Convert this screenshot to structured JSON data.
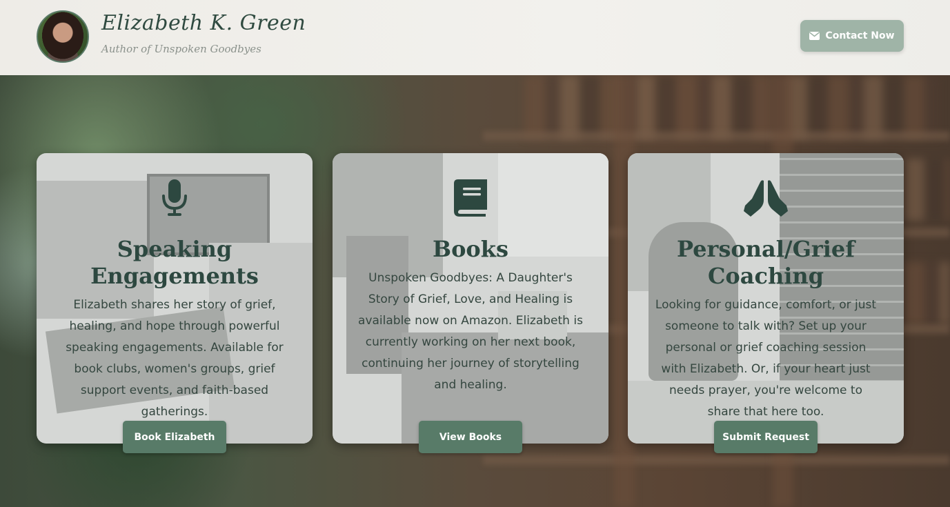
{
  "header": {
    "name": "Elizabeth K. Green",
    "tagline": "Author of Unspoken Goodbyes",
    "contact_label": "Contact Now",
    "contact_icon": "envelope-icon"
  },
  "colors": {
    "accent": "#587b68",
    "contact_button": "#9fb4a7",
    "title_text": "#2d4840"
  },
  "cards": [
    {
      "icon": "microphone-icon",
      "title": "Speaking Engagements",
      "text": "Elizabeth shares her story of grief, healing, and hope through powerful speaking engagements. Available for book clubs, women's groups, grief support events, and faith-based gatherings.",
      "button": "Book Elizabeth"
    },
    {
      "icon": "book-icon",
      "title": "Books",
      "text": "Unspoken Goodbyes: A Daughter's Story of Grief, Love, and Healing is available now on Amazon. Elizabeth is currently working on her next book, continuing her journey of storytelling and healing.",
      "button": "View Books"
    },
    {
      "icon": "praying-hands-icon",
      "title": "Personal/Grief Coaching",
      "text": "Looking for guidance, comfort, or just someone to talk with? Set up your personal or grief coaching session with Elizabeth. Or, if your heart just needs prayer, you're welcome to share that here too.",
      "button": "Submit Request"
    }
  ]
}
